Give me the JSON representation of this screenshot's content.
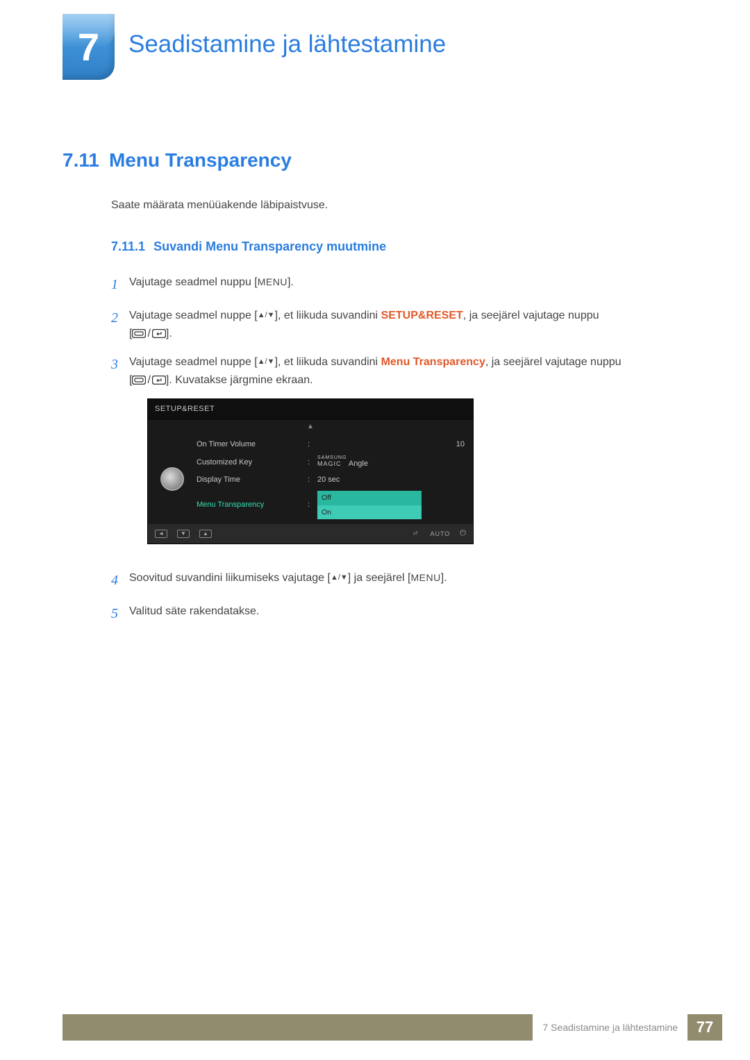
{
  "chapter": {
    "number": "7",
    "title": "Seadistamine ja lähtestamine"
  },
  "section": {
    "number": "7.11",
    "title": "Menu Transparency",
    "intro": "Saate määrata menüüakende läbipaistvuse."
  },
  "subsection": {
    "number": "7.11.1",
    "title": "Suvandi Menu Transparency muutmine"
  },
  "steps": {
    "s1": {
      "num": "1",
      "pre": "Vajutage seadmel nuppu [",
      "menu": "MENU",
      "post": "]."
    },
    "s2": {
      "num": "2",
      "pre": "Vajutage seadmel nuppe [",
      "mid": "], et liikuda suvandini ",
      "hl": "SETUP&RESET",
      "post1": ", ja seejärel vajutage nuppu",
      "post2": "[",
      "post3": "]."
    },
    "s3": {
      "num": "3",
      "pre": "Vajutage seadmel nuppe [",
      "mid": "], et liikuda suvandini ",
      "hl": "Menu Transparency",
      "post1": ", ja seejärel vajutage nuppu",
      "post2": "[",
      "post3": "]. Kuvatakse järgmine ekraan."
    },
    "s4": {
      "num": "4",
      "pre": "Soovitud suvandini liikumiseks vajutage [",
      "mid": "] ja seejärel [",
      "menu": "MENU",
      "post": "]."
    },
    "s5": {
      "num": "5",
      "text": "Valitud säte rakendatakse."
    }
  },
  "osd": {
    "title": "SETUP&RESET",
    "rows": {
      "r1": {
        "label": "On Timer  Volume",
        "value": "",
        "right": "10"
      },
      "r2": {
        "label": "Customized Key",
        "magic_top": "SAMSUNG",
        "magic": "MAGIC",
        "value_suffix": " Angle"
      },
      "r3": {
        "label": "Display Time",
        "value": "20 sec"
      },
      "r4": {
        "label": "Menu Transparency",
        "opt_off": "Off",
        "opt_on": "On"
      }
    },
    "footer": {
      "auto": "AUTO"
    }
  },
  "footer": {
    "chapter_label": "7 Seadistamine ja lähtestamine",
    "page": "77"
  }
}
